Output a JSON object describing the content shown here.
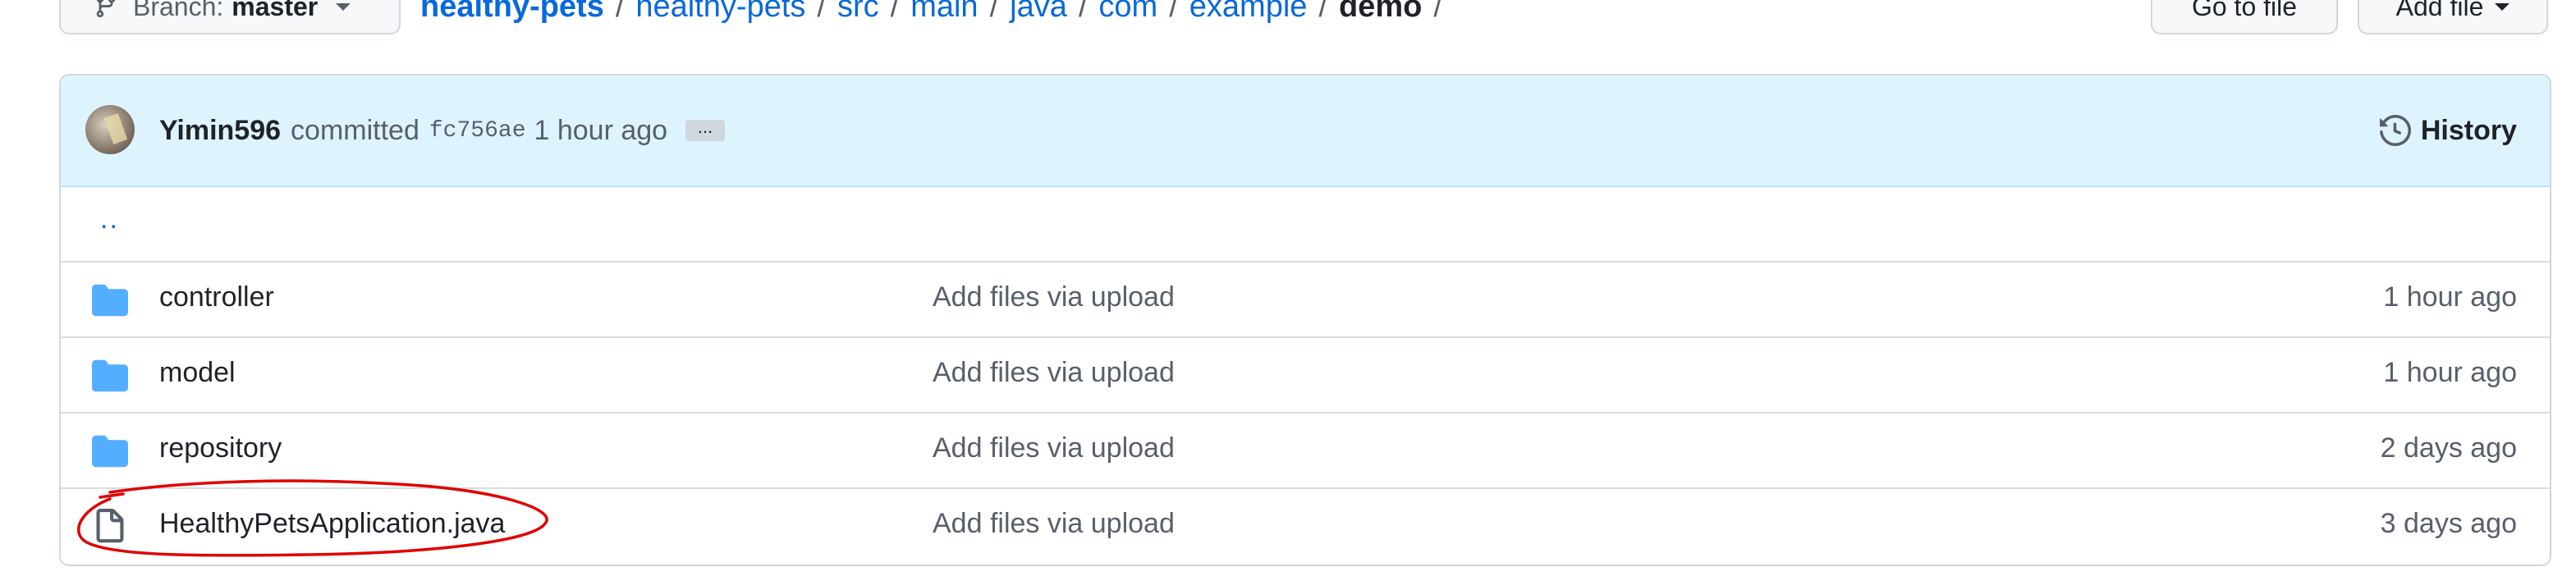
{
  "toolbar": {
    "branch_prefix": "Branch:",
    "branch_name": "master",
    "goto_file_label": "Go to file",
    "add_file_label": "Add file"
  },
  "breadcrumb": {
    "items": [
      "healthy-pets",
      "healthy-pets",
      "src",
      "main",
      "java",
      "com",
      "example"
    ],
    "current": "demo",
    "separator": "/"
  },
  "commit": {
    "author": "Yimin596",
    "action": "committed",
    "sha": "fc756ae",
    "time": "1 hour ago",
    "ellipsis": "...",
    "history_label": "History"
  },
  "files": {
    "parent_link": "..",
    "rows": [
      {
        "type": "folder",
        "name": "controller",
        "message": "Add files via upload",
        "age": "1 hour ago"
      },
      {
        "type": "folder",
        "name": "model",
        "message": "Add files via upload",
        "age": "1 hour ago"
      },
      {
        "type": "folder",
        "name": "repository",
        "message": "Add files via upload",
        "age": "2 days ago"
      },
      {
        "type": "file",
        "name": "HealthyPetsApplication.java",
        "message": "Add files via upload",
        "age": "3 days ago"
      }
    ]
  },
  "colors": {
    "link": "#0969da",
    "folder": "#54aeff",
    "commit_bg": "#ddf4ff",
    "annotation": "#e00000"
  }
}
